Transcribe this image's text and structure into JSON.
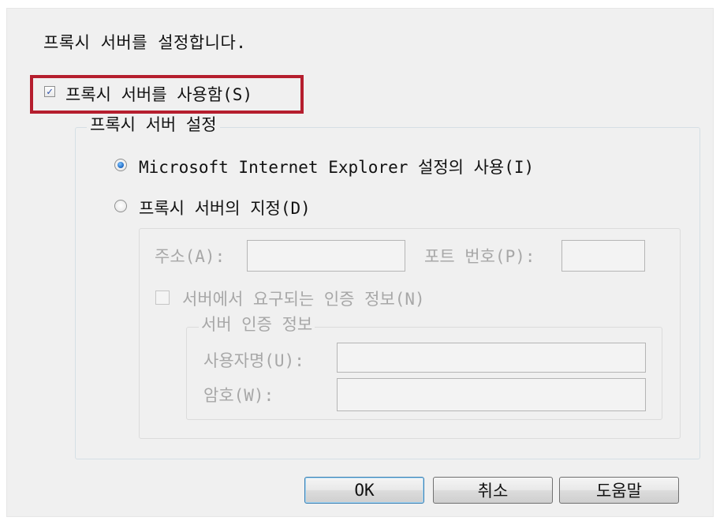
{
  "dialog": {
    "intro_text": "프록시 서버를 설정합니다.",
    "enable_proxy": {
      "label": "프록시 서버를 사용함(S)",
      "checked": true,
      "check_mark": "✓"
    },
    "settings_group": {
      "title": "프록시 서버 설정",
      "radio_ie": {
        "label": "Microsoft Internet Explorer 설정의 사용(I)",
        "selected": true
      },
      "radio_manual": {
        "label": "프록시 서버의 지정(D)",
        "selected": false
      },
      "manual": {
        "address_label": "주소(A):",
        "address_value": "",
        "port_label": "포트 번호(P):",
        "port_value": "",
        "auth_required": {
          "label": "서버에서 요구되는 인증 정보(N)",
          "checked": false
        },
        "auth_group": {
          "title": "서버 인증 정보",
          "username_label": "사용자명(U):",
          "username_value": "",
          "password_label": "암호(W):",
          "password_value": ""
        }
      }
    },
    "buttons": {
      "ok": "OK",
      "cancel": "취소",
      "help": "도움말"
    }
  },
  "colors": {
    "highlight": "#b51e2e",
    "dialog_bg": "#f0f0f0",
    "disabled_text": "#a7a7a7"
  }
}
